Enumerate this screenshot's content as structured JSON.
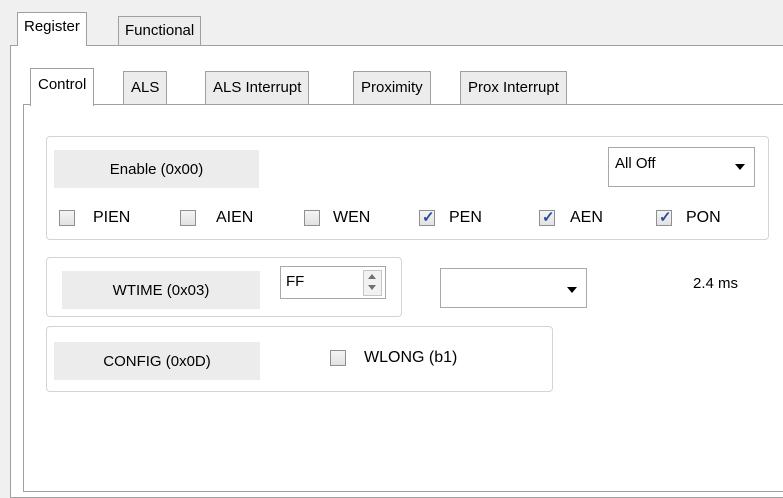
{
  "outer_tabs": [
    "Register",
    "Functional"
  ],
  "inner_tabs": [
    "Control",
    "ALS",
    "ALS Interrupt",
    "Proximity",
    "Prox Interrupt"
  ],
  "enable": {
    "label": "Enable (0x00)",
    "preset": "All Off",
    "checkboxes": [
      {
        "label": "PIEN",
        "checked": false
      },
      {
        "label": "AIEN",
        "checked": false
      },
      {
        "label": "WEN",
        "checked": false
      },
      {
        "label": "PEN",
        "checked": true
      },
      {
        "label": "AEN",
        "checked": true
      },
      {
        "label": "PON",
        "checked": true
      }
    ]
  },
  "wtime": {
    "label": "WTIME (0x03)",
    "value": "FF",
    "dropdown_value": "",
    "time": "2.4 ms"
  },
  "config": {
    "label": "CONFIG (0x0D)",
    "checkbox": {
      "label": "WLONG (b1)",
      "checked": false
    }
  },
  "colors": {
    "checkmark": "#2b4e9a",
    "panel": "#ffffff",
    "window": "#f0f0f0"
  }
}
